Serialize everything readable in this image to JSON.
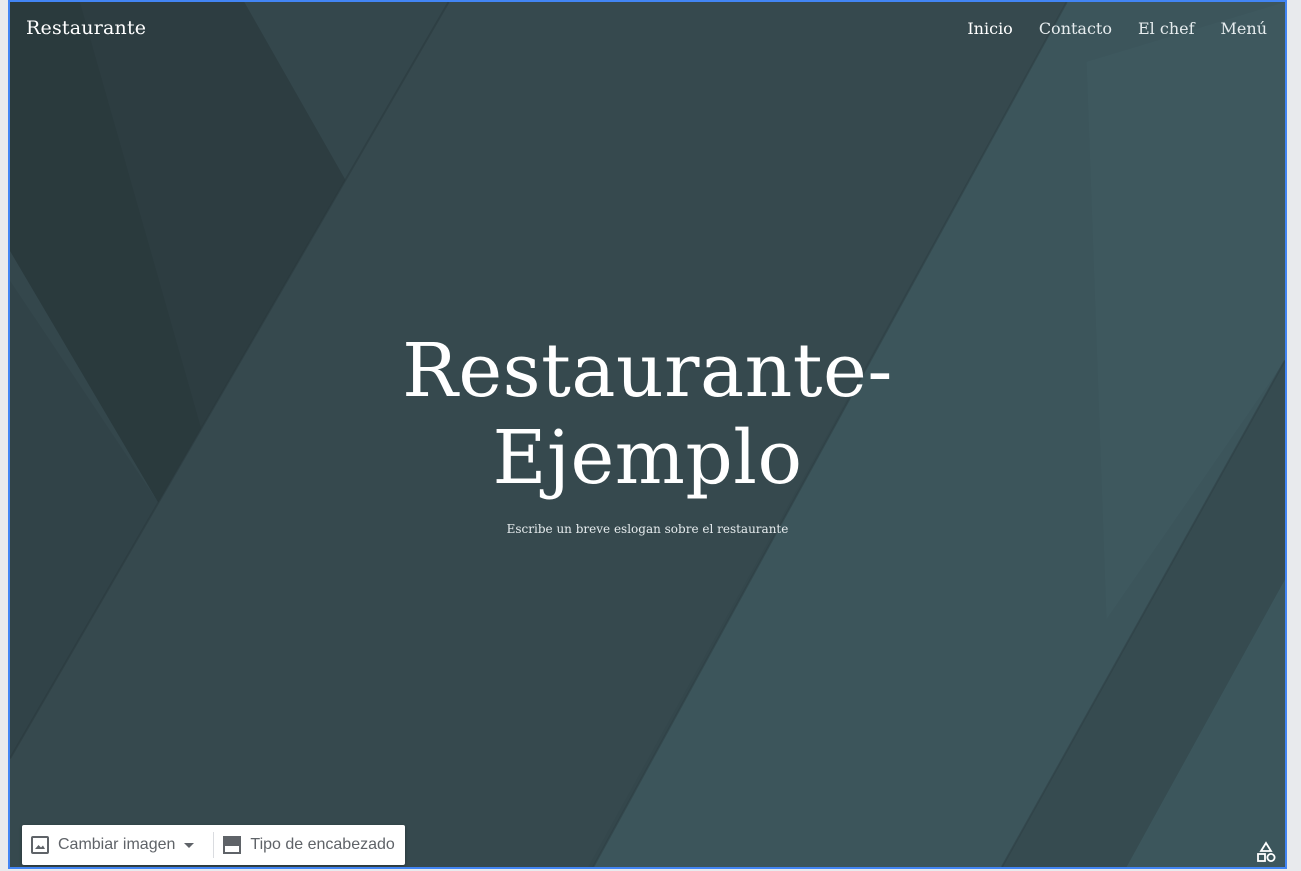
{
  "site": {
    "title": "Restaurante"
  },
  "nav": {
    "items": [
      {
        "label": "Inicio"
      },
      {
        "label": "Contacto"
      },
      {
        "label": "El chef"
      },
      {
        "label": "Menú"
      }
    ]
  },
  "hero": {
    "title_line1": "Restaurante-",
    "title_line2": "Ejemplo",
    "subtitle": "Escribe un breve eslogan sobre el restaurante"
  },
  "toolbar": {
    "change_image_label": "Cambiar imagen",
    "header_type_label": "Tipo de encabezado"
  },
  "icons": {
    "change_image": "image-icon",
    "dropdown": "caret-down-icon",
    "header_type": "header-layout-icon",
    "shapes": "shapes-icon"
  },
  "colors": {
    "selection_border": "#4285f4",
    "background_dark": "#2c3b3f",
    "background_teal": "#3d5b62"
  }
}
